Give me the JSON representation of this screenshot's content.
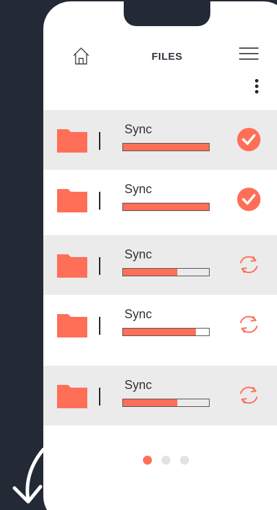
{
  "header": {
    "title": "FILES",
    "home_icon": "home-icon",
    "menu_icon": "hamburger-menu-icon",
    "more_icon": "more-vertical-icon"
  },
  "colors": {
    "accent": "#ff6f57",
    "background": "#232a36",
    "row_shade": "#ebebeb"
  },
  "files": [
    {
      "label": "Sync",
      "progress": 1.0,
      "status": "done",
      "status_icon": "check-circle-icon",
      "shaded": true
    },
    {
      "label": "Sync",
      "progress": 1.0,
      "status": "done",
      "status_icon": "check-circle-icon",
      "shaded": false
    },
    {
      "label": "Sync",
      "progress": 0.63,
      "status": "syncing",
      "status_icon": "sync-icon",
      "shaded": true
    },
    {
      "label": "Sync",
      "progress": 0.85,
      "status": "syncing",
      "status_icon": "sync-icon",
      "shaded": false
    },
    {
      "label": "Sync",
      "progress": 0.63,
      "status": "syncing",
      "status_icon": "sync-icon",
      "shaded": true
    }
  ],
  "pagination": {
    "count": 3,
    "active": 0
  }
}
